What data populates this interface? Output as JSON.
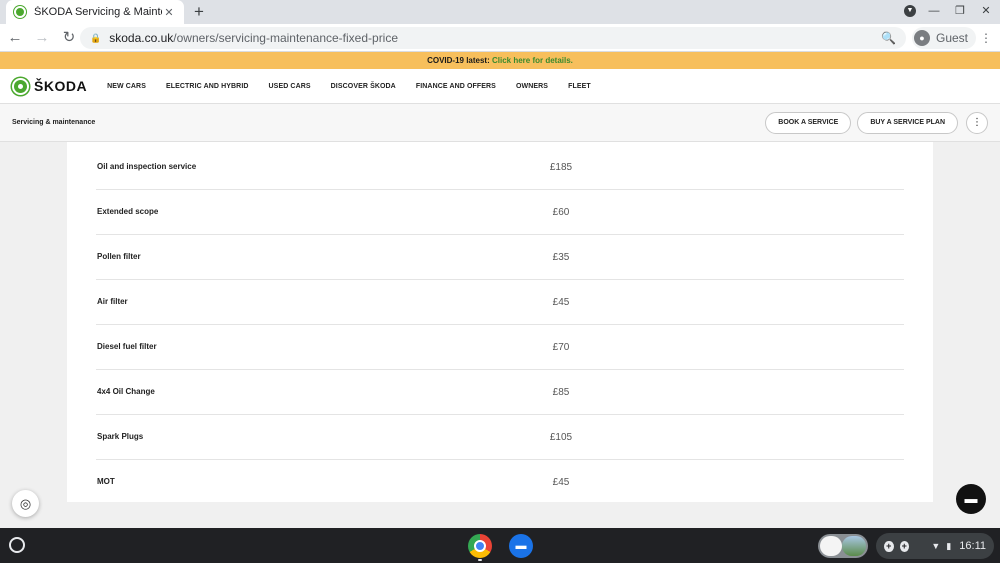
{
  "browser": {
    "tab_title": "ŠKODA Servicing & Maintenance",
    "tab_close": "✕",
    "new_tab": "+",
    "url_domain": "skoda.co.uk",
    "url_path": "/owners/servicing-maintenance-fixed-price",
    "profile_name": "Guest"
  },
  "banner": {
    "prefix": "COVID-19 latest: ",
    "link": "Click here for details."
  },
  "site": {
    "logo_text": "ŠKODA",
    "nav": [
      "NEW CARS",
      "ELECTRIC AND HYBRID",
      "USED CARS",
      "DISCOVER ŠKODA",
      "FINANCE AND OFFERS",
      "OWNERS",
      "FLEET"
    ]
  },
  "subnav": {
    "title": "Servicing & maintenance",
    "book_service": "BOOK A SERVICE",
    "buy_plan": "BUY A SERVICE PLAN"
  },
  "price_table": {
    "rows": [
      {
        "label": "Oil and inspection service",
        "price": "£185"
      },
      {
        "label": "Extended scope",
        "price": "£60"
      },
      {
        "label": "Pollen filter",
        "price": "£35"
      },
      {
        "label": "Air filter",
        "price": "£45"
      },
      {
        "label": "Diesel fuel filter",
        "price": "£70"
      },
      {
        "label": "4x4 Oil Change",
        "price": "£85"
      },
      {
        "label": "Spark Plugs",
        "price": "£105"
      },
      {
        "label": "MOT",
        "price": "£45"
      }
    ]
  },
  "shelf": {
    "time": "16:11"
  },
  "icons": {
    "cookie": "cookie-icon",
    "chat": "chat-icon"
  }
}
